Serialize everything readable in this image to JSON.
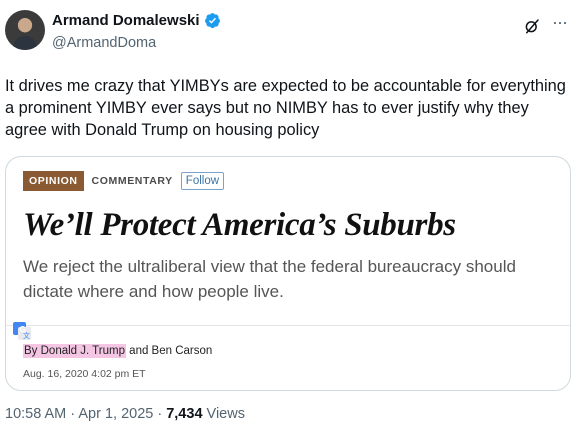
{
  "author": {
    "display_name": "Armand Domalewski",
    "handle": "@ArmandDoma",
    "verified_icon": "verified-badge-icon",
    "verified_color": "#1d9bf0"
  },
  "header_actions": {
    "grok_icon": "grok-icon",
    "more_icon": "more-options-icon",
    "more_label": "···"
  },
  "tweet": {
    "text": "It drives me crazy that YIMBYs are expected to be accountable for everything a prominent YIMBY ever says but no NIMBY has to ever justify why they agree with Donald Trump on housing policy"
  },
  "card": {
    "tag": "OPINION",
    "section": "COMMENTARY",
    "follow_label": "Follow",
    "headline": "We’ll Protect America’s Suburbs",
    "dek": "We reject the ultraliberal view that the federal bureaucracy should dictate where and how people live.",
    "byline_prefix": "By Donald J. Trump",
    "byline_suffix": " and Ben Carson",
    "dateline": "Aug. 16, 2020 4:02 pm ET",
    "tag_color": "#8a5a32",
    "highlight_color": "#f4c6e4"
  },
  "meta": {
    "time": "10:58 AM · Apr 1, 2025 · ",
    "views_count": "7,434",
    "views_label": " Views"
  }
}
